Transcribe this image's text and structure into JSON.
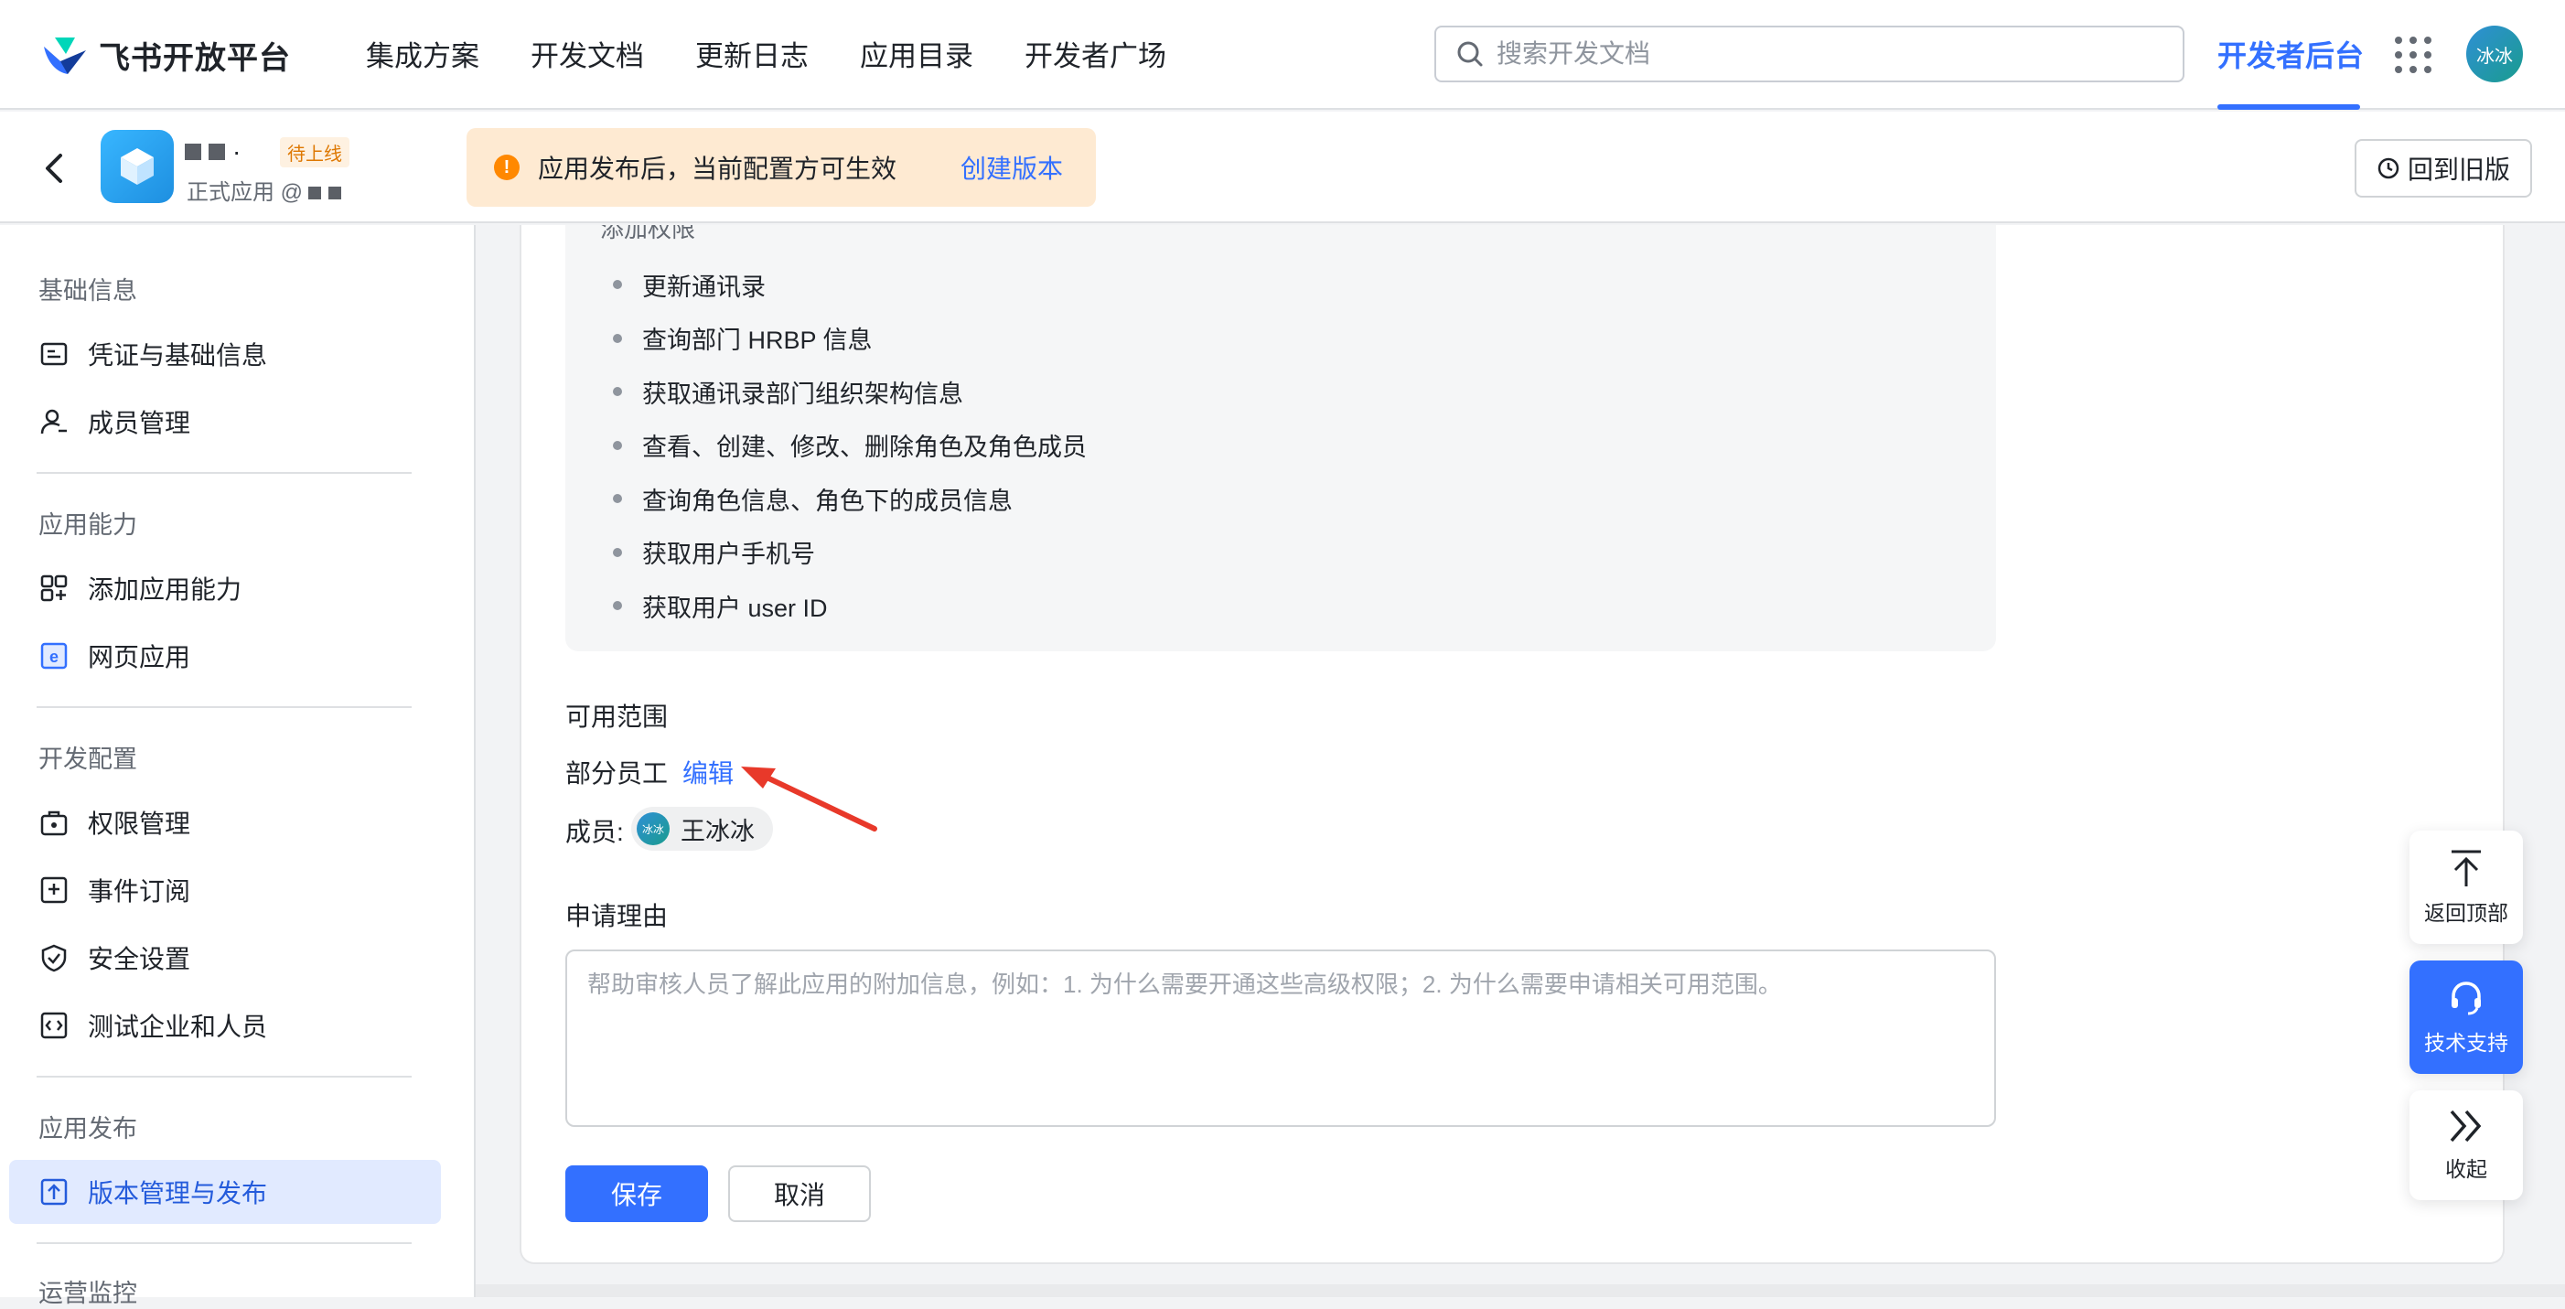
{
  "brand": {
    "name": "飞书开放平台"
  },
  "nav": {
    "links": [
      "集成方案",
      "开发文档",
      "更新日志",
      "应用目录",
      "开发者广场"
    ],
    "dev_console": "开发者后台",
    "user_initials": "冰冰"
  },
  "search": {
    "placeholder": "搜索开发文档"
  },
  "app": {
    "name_dot": "·",
    "status": "待上线",
    "type": "正式应用 @"
  },
  "notice": {
    "text": "应用发布后，当前配置方可生效",
    "link": "创建版本"
  },
  "old_version_button": "回到旧版",
  "sidebar": {
    "groups": [
      "基础信息",
      "应用能力",
      "开发配置",
      "应用发布",
      "运营监控"
    ],
    "items": [
      {
        "label": "凭证与基础信息",
        "icon": "credential-icon"
      },
      {
        "label": "成员管理",
        "icon": "member-icon"
      },
      {
        "label": "添加应用能力",
        "icon": "add-capability-icon"
      },
      {
        "label": "网页应用",
        "icon": "web-app-icon"
      },
      {
        "label": "权限管理",
        "icon": "permission-icon"
      },
      {
        "label": "事件订阅",
        "icon": "event-icon"
      },
      {
        "label": "安全设置",
        "icon": "shield-icon"
      },
      {
        "label": "测试企业和人员",
        "icon": "code-icon"
      },
      {
        "label": "版本管理与发布",
        "icon": "upload-icon"
      }
    ]
  },
  "permissions": {
    "heading": "添加权限",
    "items": [
      "更新通讯录",
      "查询部门 HRBP 信息",
      "获取通讯录部门组织架构信息",
      "查看、创建、修改、删除角色及角色成员",
      "查询角色信息、角色下的成员信息",
      "获取用户手机号",
      "获取用户 user ID"
    ]
  },
  "scope": {
    "title": "可用范围",
    "value": "部分员工",
    "edit": "编辑",
    "member_label": "成员:",
    "member_name": "王冰冰",
    "member_initials": "冰冰"
  },
  "reason": {
    "title": "申请理由",
    "placeholder": "帮助审核人员了解此应用的附加信息，例如：1. 为什么需要开通这些高级权限；2. 为什么需要申请相关可用范围。"
  },
  "buttons": {
    "save": "保存",
    "cancel": "取消"
  },
  "floating": {
    "top": "返回顶部",
    "support": "技术支持",
    "collapse": "收起"
  },
  "colors": {
    "accent": "#3370ff",
    "warning": "#ff8800",
    "annotation": "#e8392a"
  }
}
